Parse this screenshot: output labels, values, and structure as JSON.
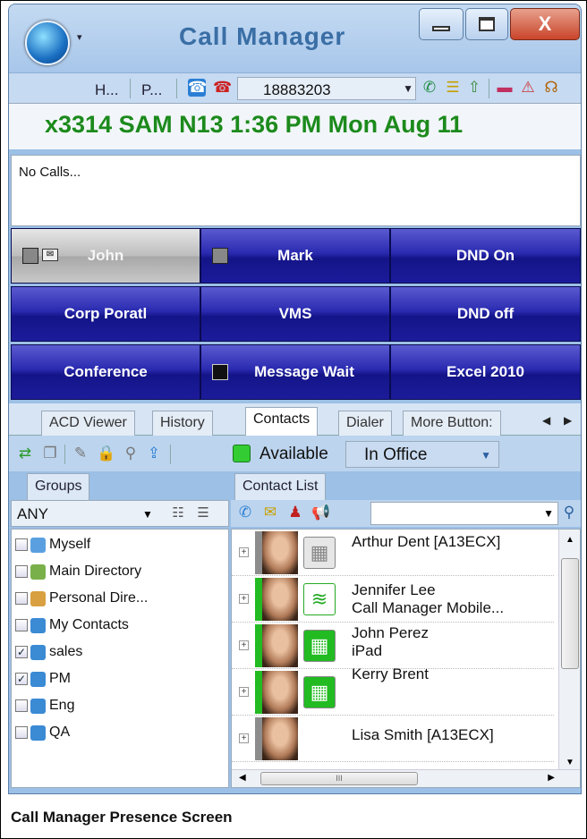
{
  "window": {
    "title": "Call Manager",
    "close_glyph": "X"
  },
  "toolbar": {
    "item1": "H...",
    "item2": "P...",
    "number": "18883203"
  },
  "status_line": "x3314 SAM  N13  1:36 PM Mon Aug 11",
  "call_area": {
    "text": "No Calls..."
  },
  "buttons": [
    {
      "label": "John"
    },
    {
      "label": "Mark"
    },
    {
      "label": "DND On"
    },
    {
      "label": "Corp Poratl"
    },
    {
      "label": "VMS"
    },
    {
      "label": "DND off"
    },
    {
      "label": "Conference"
    },
    {
      "label": "Message Wait"
    },
    {
      "label": "Excel 2010"
    }
  ],
  "tabs": [
    "ACD Viewer",
    "History",
    "Contacts",
    "Dialer",
    "More Button:"
  ],
  "active_tab": "Contacts",
  "presence": {
    "status": "Available",
    "status_color": "#33cc33",
    "location": "In Office"
  },
  "groups": {
    "tab": "Groups",
    "filter": "ANY",
    "items": [
      {
        "label": "Myself",
        "checked": ""
      },
      {
        "label": "Main Directory",
        "checked": ""
      },
      {
        "label": "Personal Dire...",
        "checked": ""
      },
      {
        "label": "My Contacts",
        "checked": ""
      },
      {
        "label": "sales",
        "checked": "✓"
      },
      {
        "label": "PM",
        "checked": "✓"
      },
      {
        "label": "Eng",
        "checked": ""
      },
      {
        "label": "QA",
        "checked": ""
      }
    ]
  },
  "contacts": {
    "tab": "Contact List",
    "scroll_thumb": "III",
    "rows": [
      {
        "name": "Arthur Dent [A13ECX]",
        "sub": "",
        "presence": "#8c8c8c"
      },
      {
        "name": "Jennifer Lee",
        "sub": "Call Manager Mobile...",
        "presence": "#22bb22"
      },
      {
        "name": "John Perez",
        "sub": "iPad",
        "presence": "#22bb22"
      },
      {
        "name": "Kerry Brent",
        "sub": "",
        "presence": "#22bb22"
      },
      {
        "name": "Lisa Smith [A13ECX]",
        "sub": "",
        "presence": "#8c8c8c"
      }
    ]
  },
  "caption": "Call Manager Presence Screen"
}
